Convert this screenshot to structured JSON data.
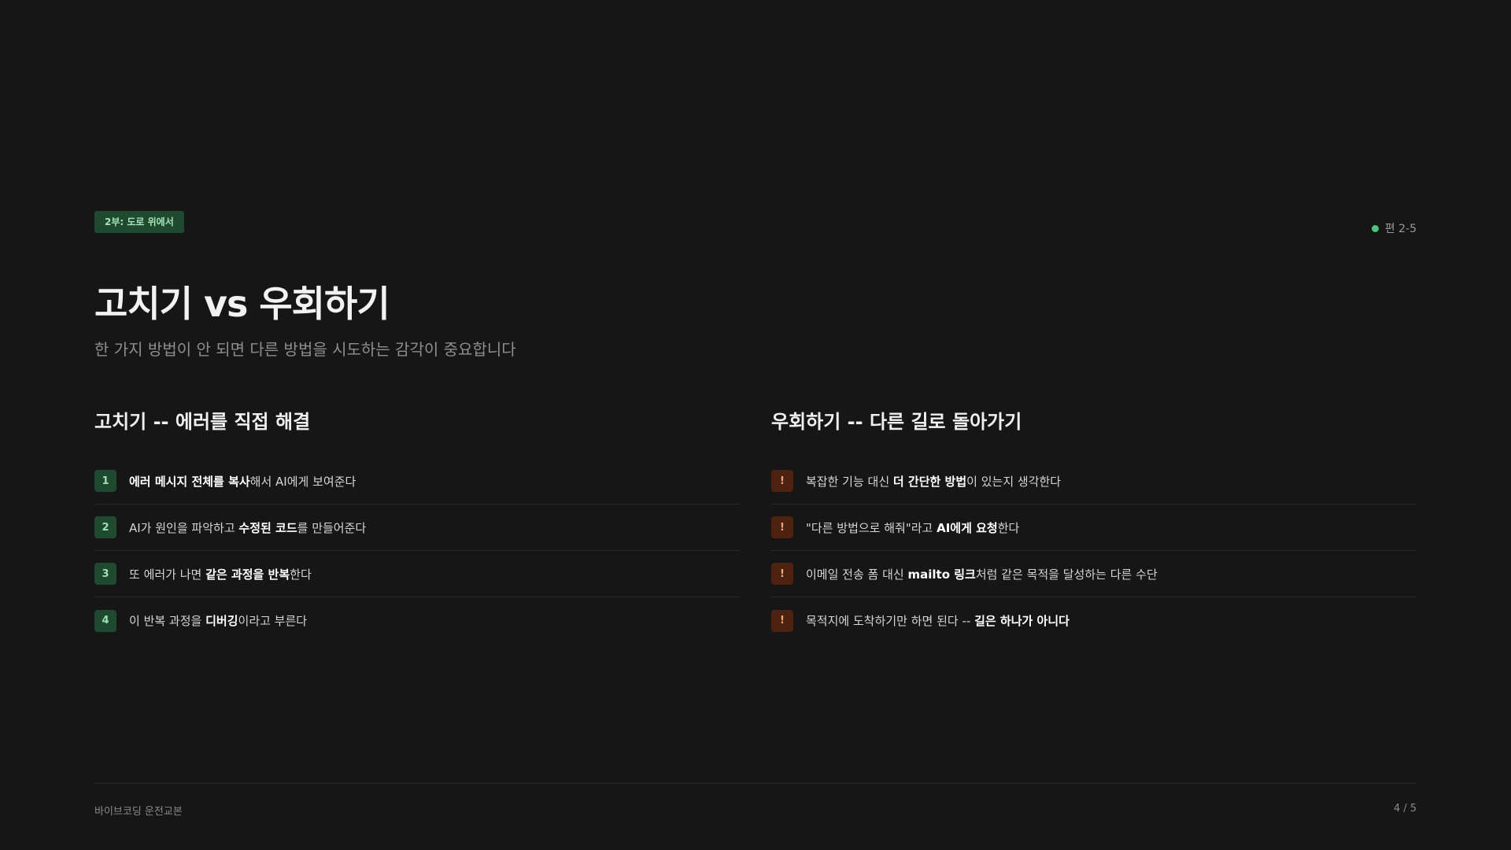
{
  "badge": "2부: 도로 위에서",
  "section_indicator": "편 2-5",
  "accent_color": "#4cc27a",
  "title": "고치기 vs 우회하기",
  "subtitle": "한 가지 방법이 안 되면 다른 방법을 시도하는 감각이 중요합니다",
  "left_column": {
    "heading": "고치기 -- 에러를 직접 해결",
    "items": [
      {
        "marker": "1",
        "parts": [
          {
            "bold": true,
            "text": "에러 메시지 전체를 복사"
          },
          {
            "bold": false,
            "text": "해서 AI에게 보여준다"
          }
        ]
      },
      {
        "marker": "2",
        "parts": [
          {
            "bold": false,
            "text": "AI가 원인을 파악하고 "
          },
          {
            "bold": true,
            "text": "수정된 코드"
          },
          {
            "bold": false,
            "text": "를 만들어준다"
          }
        ]
      },
      {
        "marker": "3",
        "parts": [
          {
            "bold": false,
            "text": "또 에러가 나면 "
          },
          {
            "bold": true,
            "text": "같은 과정을 반복"
          },
          {
            "bold": false,
            "text": "한다"
          }
        ]
      },
      {
        "marker": "4",
        "parts": [
          {
            "bold": false,
            "text": "이 반복 과정을 "
          },
          {
            "bold": true,
            "text": "디버깅"
          },
          {
            "bold": false,
            "text": "이라고 부른다"
          }
        ]
      }
    ]
  },
  "right_column": {
    "heading": "우회하기 -- 다른 길로 돌아가기",
    "items": [
      {
        "marker": "!",
        "parts": [
          {
            "bold": false,
            "text": "복잡한 기능 대신 "
          },
          {
            "bold": true,
            "text": "더 간단한 방법"
          },
          {
            "bold": false,
            "text": "이 있는지 생각한다"
          }
        ]
      },
      {
        "marker": "!",
        "parts": [
          {
            "bold": false,
            "text": "\"다른 방법으로 해줘\"라고 "
          },
          {
            "bold": true,
            "text": "AI에게 요청"
          },
          {
            "bold": false,
            "text": "한다"
          }
        ]
      },
      {
        "marker": "!",
        "parts": [
          {
            "bold": false,
            "text": "이메일 전송 폼 대신 "
          },
          {
            "bold": true,
            "text": "mailto 링크"
          },
          {
            "bold": false,
            "text": "처럼 같은 목적을 달성하는 다른 수단"
          }
        ]
      },
      {
        "marker": "!",
        "parts": [
          {
            "bold": false,
            "text": "목적지에 도착하기만 하면 된다 -- "
          },
          {
            "bold": true,
            "text": "길은 하나가 아니다"
          }
        ]
      }
    ]
  },
  "footer": {
    "left": "바이브코딩 운전교본",
    "right": "4 / 5"
  }
}
